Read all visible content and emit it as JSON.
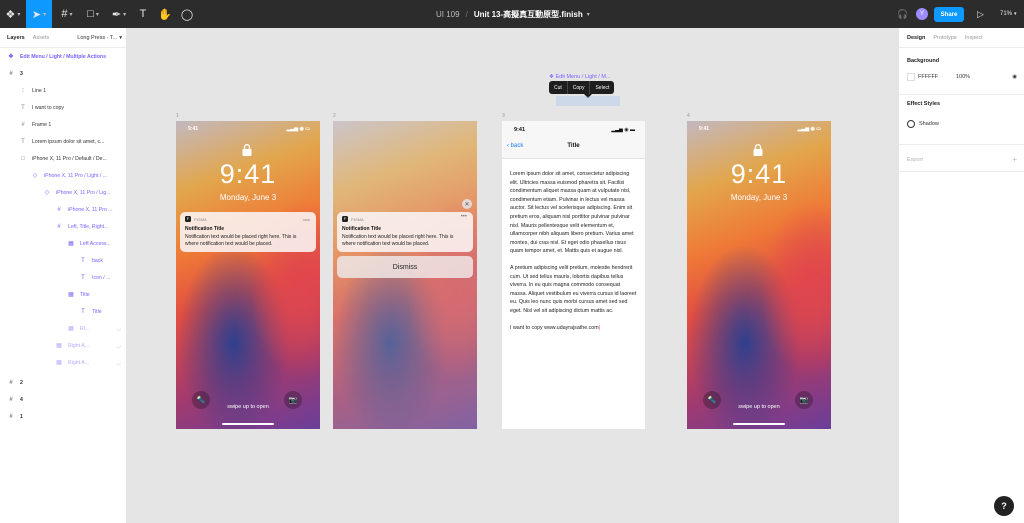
{
  "topbar": {
    "file_project": "UI 109",
    "file_separator": "/",
    "file_name": "Unit 13-高擬真互動原型.finish",
    "share_label": "Share",
    "avatar_initial": "Y",
    "zoom": "71%"
  },
  "left_panel": {
    "tab_layers": "Layers",
    "tab_assets": "Assets",
    "page_select": "Long Press - T...",
    "layers": [
      {
        "label": "Edit Menu / Light / Multiple Actions",
        "icon": "component-icon"
      },
      {
        "label": "3",
        "icon": "frame-icon"
      },
      {
        "label": "Line 1",
        "icon": "text-icon"
      },
      {
        "label": "I want to copy",
        "icon": "text-icon"
      },
      {
        "label": "Frame 1",
        "icon": "frame-icon"
      },
      {
        "label": "Lorem ipsum dolor sit amet, c...",
        "icon": "text-icon"
      },
      {
        "label": "iPhone X, 11 Pro / Default / De...",
        "icon": "rect-icon"
      },
      {
        "label": "iPhone X, 11 Pro / Light / ...",
        "icon": "instance-icon"
      },
      {
        "label": "iPhone X, 11 Pro / Lig...",
        "icon": "instance-icon"
      },
      {
        "label": "iPhone X, 11 Pro ...",
        "icon": "frame-icon"
      },
      {
        "label": "Left, Title, Right...",
        "icon": "frame-icon"
      },
      {
        "label": "Left Access...",
        "icon": "group-icon"
      },
      {
        "label": "back",
        "icon": "text-icon"
      },
      {
        "label": "Icon / ...",
        "icon": "text-icon"
      },
      {
        "label": "Title",
        "icon": "group-icon"
      },
      {
        "label": "Title",
        "icon": "text-icon"
      },
      {
        "label": "Ri...",
        "icon": "group-icon"
      },
      {
        "label": "Right A...",
        "icon": "group-icon"
      },
      {
        "label": "Right A...",
        "icon": "group-icon"
      },
      {
        "label": "2",
        "icon": "frame-icon"
      },
      {
        "label": "4",
        "icon": "frame-icon"
      },
      {
        "label": "1",
        "icon": "frame-icon"
      }
    ]
  },
  "right_panel": {
    "tab_design": "Design",
    "tab_prototype": "Prototype",
    "tab_inspect": "Inspect",
    "background_title": "Background",
    "background_hex": "FFFFFF",
    "background_opacity": "100%",
    "effect_styles_title": "Effect Styles",
    "effect_style_name": "Shadow",
    "export_title": "Export"
  },
  "canvas": {
    "frame_labels": [
      "1",
      "2",
      "3",
      "4"
    ],
    "lock": {
      "time": "9:41",
      "clock": "9:41",
      "date": "Monday, June 3",
      "swipe_text": "swipe up to open"
    },
    "notification": {
      "app_name": "FIGMA",
      "time": "now",
      "title": "Notification Title",
      "body": "Notification text would be placed right here. This is where notification text would be placed."
    },
    "dismiss_label": "Dismiss",
    "edit_menu": {
      "label": "Edit Menu / Light / M...",
      "items": [
        "Cut",
        "Copy",
        "Select"
      ]
    },
    "doc": {
      "time": "9:41",
      "back_label": "back",
      "title": "Title",
      "para1": "Lorem ipsum dolor sit amet, consectetur adipiscing elit. Ultricies massa euismod pharetra sit. Facilisi condimentum aliquet massa quam at vulputate nisl, condimentum etiam. Pulvinar in lectus vel massa auctor. Sit lectus vel scelerisque adipiscing. Enim sit pretium eros, aliquam nisl porttitor pulvinar pulvinar nisl. Mauris pellentesque velit elementum et, ullamcorper nibh aliquam libero pretium. Varius amet montes, dui cras nisl. Et eget odio phasellus risus quam tempor amet, et. Mattis quis et augue nisl.",
      "para2": "A pretium adipiscing velit pretium, molestie hendrerit cum. Ut sed tellus mauris, lobortis dapibus tellus viverra. In eu quis magna commodo consequat massa. Aliquet vestibulum eu viverra cursus id laoreet eu. Quis leo nunc quis morbi cursus amet sed sed eget. Nisl vel sit adipiscing dictum mattis ac.",
      "para3": "I want to copy www.udayrajsathe.com"
    }
  },
  "colors": {
    "accent": "#0d99ff",
    "component": "#7b61ff",
    "topbar": "#2c2c2c"
  }
}
